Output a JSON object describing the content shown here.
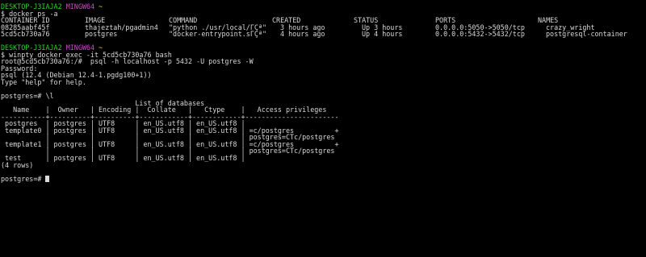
{
  "prompt1": {
    "host": "DESKTOP-J3IAJA2",
    "shell": "MINGW64",
    "path": "~"
  },
  "cmd1": "$ docker ps -a",
  "ps_headers": [
    "CONTAINER ID",
    "IMAGE",
    "COMMAND",
    "CREATED",
    "STATUS",
    "PORTS",
    "NAMES"
  ],
  "ps_rows": [
    [
      "08285aabf45f",
      "thajeztah/pgadmin4",
      "\"python ./usr/local/ΓÇª\"",
      "3 hours ago",
      "Up 3 hours",
      "0.0.0.0:5050->5050/tcp",
      "crazy_wright"
    ],
    [
      "5cd5cb730a76",
      "postgres",
      "\"docker-entrypoint.sΓÇª\"",
      "4 hours ago",
      "Up 4 hours",
      "0.0.0.0:5432->5432/tcp",
      "postgresql-container"
    ]
  ],
  "prompt2": {
    "host": "DESKTOP-J3IAJA2",
    "shell": "MINGW64",
    "path": "~"
  },
  "cmd2": "$ winpty docker exec -it 5cd5cb730a76 bash",
  "root_cmd": "root@5cd5cb730a76:/#  psql -h localhost -p 5432 -U postgres -W",
  "password_line": "Password:",
  "psql_version": "psql (12.4 (Debian 12.4-1.pgdg100+1))",
  "help_line": "Type \"help\" for help.",
  "psql_cmd": "postgres=# \\l",
  "db_list": [
    "                                 List of databases",
    "   Name    |  Owner   | Encoding |  Collate   |   Ctype    |   Access privileges   ",
    "-----------+----------+----------+------------+------------+-----------------------",
    " postgres  | postgres | UTF8     | en_US.utf8 | en_US.utf8 | ",
    " template0 | postgres | UTF8     | en_US.utf8 | en_US.utf8 | =c/postgres          +",
    "           |          |          |            |            | postgres=CTc/postgres",
    " template1 | postgres | UTF8     | en_US.utf8 | en_US.utf8 | =c/postgres          +",
    "           |          |          |            |            | postgres=CTc/postgres",
    " test      | postgres | UTF8     | en_US.utf8 | en_US.utf8 | ",
    "(4 rows)"
  ],
  "final_prompt": "postgres=# "
}
